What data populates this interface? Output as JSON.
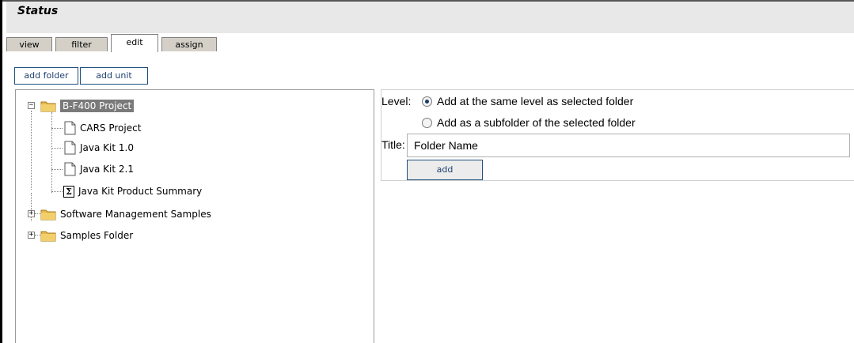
{
  "window": {
    "title": "Status"
  },
  "tabs": [
    {
      "label": "view"
    },
    {
      "label": "filter"
    },
    {
      "label": "edit",
      "active": true
    },
    {
      "label": "assign"
    }
  ],
  "toolbar": {
    "add_folder": "add folder",
    "add_unit": "add unit"
  },
  "tree": {
    "nodes": [
      {
        "label": "B-F400 Project",
        "type": "folder",
        "expanded": true,
        "selected": true
      },
      {
        "label": "CARS Project",
        "type": "document"
      },
      {
        "label": "Java Kit 1.0",
        "type": "document"
      },
      {
        "label": "Java Kit 2.1",
        "type": "document"
      },
      {
        "label": "Java Kit Product Summary",
        "type": "summary"
      },
      {
        "label": "Software Management Samples",
        "type": "folder",
        "expanded": false
      },
      {
        "label": "Samples Folder",
        "type": "folder",
        "expanded": false
      }
    ]
  },
  "form": {
    "level_label": "Level:",
    "option_same_level": "Add at the same level as selected folder",
    "option_subfolder": "Add as a subfolder of the selected folder",
    "selected_option": "same_level",
    "title_label": "Title:",
    "title_value": "Folder Name",
    "add_button": "add"
  },
  "colors": {
    "accent": "#1f4f7f",
    "selected_bg": "#7a7a7a",
    "folder": "#e6b84a"
  }
}
